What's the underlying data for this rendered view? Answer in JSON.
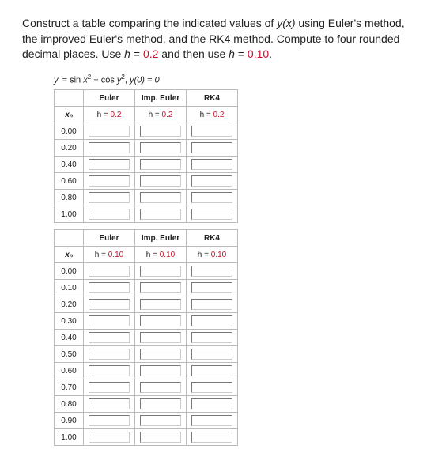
{
  "prompt": {
    "line1": "Construct a table comparing the indicated values of ",
    "yofx": "y(x)",
    "line1b": " using Euler's method, the improved Euler's method, and the RK4 method. Compute to four rounded decimal places. Use ",
    "heq": "h",
    "eq1": " = ",
    "h1": "0.2",
    "line1c": " and then use ",
    "eq2": " = ",
    "h2": "0.10",
    "period": "."
  },
  "equation": {
    "lhs_y": "y",
    "prime": "′",
    "eq": " = sin ",
    "x": "x",
    "sq1": "2",
    "plus": " + cos ",
    "y2": "y",
    "sq2": "2",
    "sep": ",   ",
    "ic": "y(0) = 0"
  },
  "headers": {
    "xn": "xₙ",
    "euler": "Euler",
    "imp": "Imp. Euler",
    "rk4": "RK4",
    "hlabel": "h = ",
    "hv02": "0.2",
    "hv01": "0.10"
  },
  "t1_rows": [
    "0.00",
    "0.20",
    "0.40",
    "0.60",
    "0.80",
    "1.00"
  ],
  "t2_rows": [
    "0.00",
    "0.10",
    "0.20",
    "0.30",
    "0.40",
    "0.50",
    "0.60",
    "0.70",
    "0.80",
    "0.90",
    "1.00"
  ]
}
